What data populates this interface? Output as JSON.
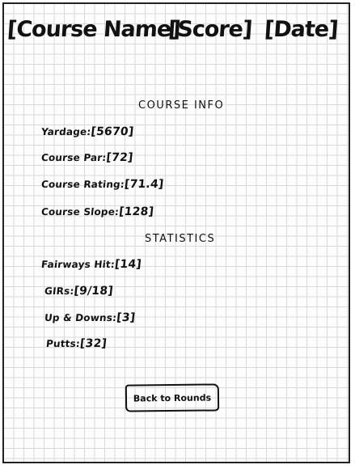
{
  "header": {
    "course_name": "[Course Name]",
    "score": "[Score]",
    "date": "[Date]"
  },
  "course_info": {
    "title": "COURSE INFO",
    "yardage": {
      "label": "Yardage:",
      "value": "[5670]"
    },
    "par": {
      "label": "Course Par:",
      "value": "[72]"
    },
    "rating": {
      "label": "Course Rating:",
      "value": "[71.4]"
    },
    "slope": {
      "label": "Course Slope:",
      "value": "[128]"
    }
  },
  "statistics": {
    "title": "STATISTICS",
    "fairways": {
      "label": "Fairways Hit:",
      "value": "[14]"
    },
    "girs": {
      "label": "GIRs:",
      "value": "[9/18]"
    },
    "up_downs": {
      "label": "Up & Downs:",
      "value": "[3]"
    },
    "putts": {
      "label": "Putts:",
      "value": "[32]"
    }
  },
  "actions": {
    "back_label": "Back to Rounds"
  }
}
